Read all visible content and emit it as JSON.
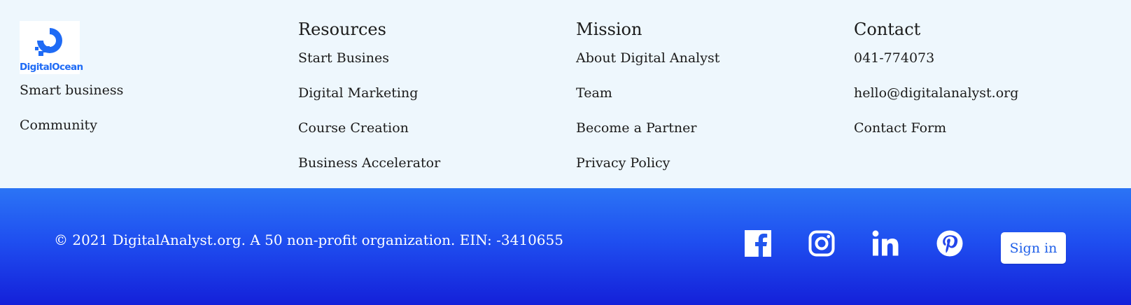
{
  "brand": {
    "logo_text": "DigitalOcean",
    "logo_icon": "digitalocean-logo-icon",
    "brand_color": "#1f6bf5"
  },
  "column1": {
    "links": [
      "Smart business",
      "Community"
    ]
  },
  "resources": {
    "heading": "Resources",
    "links": [
      "Start Busines",
      "Digital Marketing",
      "Course Creation",
      "Business Accelerator"
    ]
  },
  "mission": {
    "heading": "Mission",
    "links": [
      "About Digital Analyst",
      "Team",
      "Become a Partner",
      "Privacy Policy"
    ]
  },
  "contact": {
    "heading": "Contact",
    "links": [
      "041-774073",
      "hello@digitalanalyst.org",
      "Contact Form"
    ]
  },
  "footer": {
    "copyright": "© 2021 DigitalAnalyst.org. A 50 non-profit organization. EIN: -3410655",
    "social_icons": [
      "facebook-icon",
      "instagram-icon",
      "linkedin-icon",
      "pinterest-icon"
    ],
    "signin_label": "Sign in",
    "gradient_top": "#2b74f5",
    "gradient_bottom": "#1420d9"
  }
}
